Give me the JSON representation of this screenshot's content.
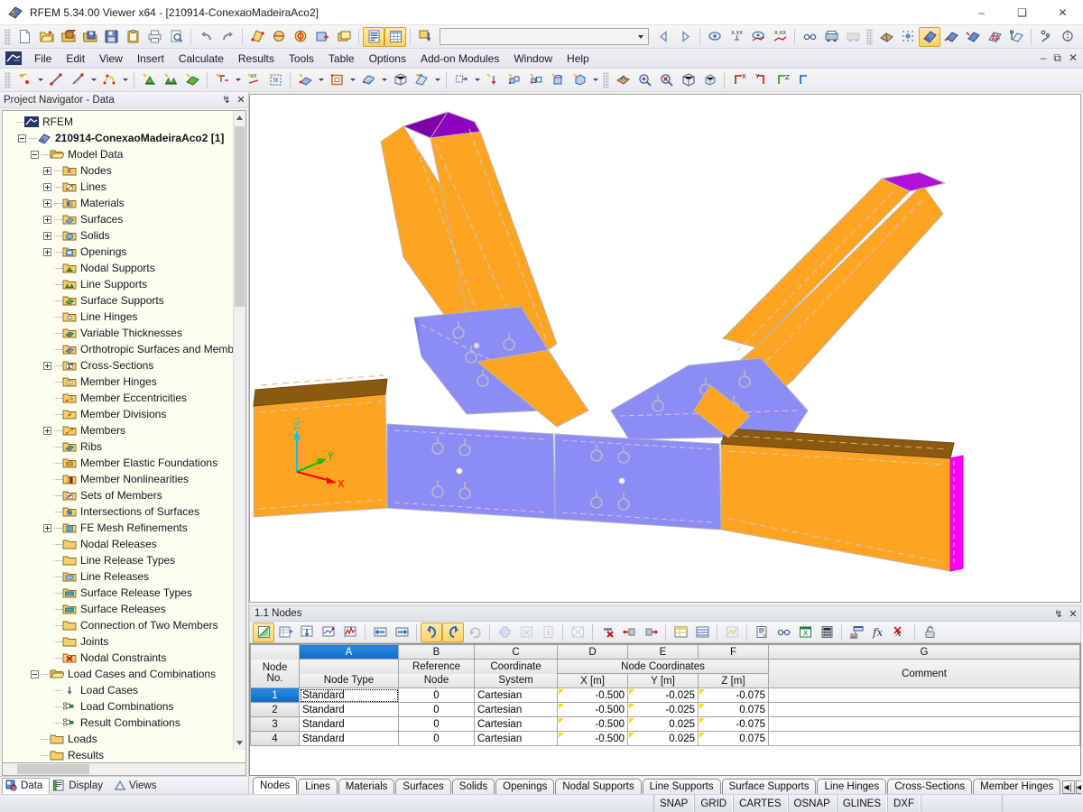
{
  "window": {
    "title": "RFEM 5.34.00 Viewer x64 - [210914-ConexaoMadeiraAco2]",
    "minimize": "–",
    "maximize": "❑",
    "close": "✕"
  },
  "menubar": {
    "items": [
      "File",
      "Edit",
      "View",
      "Insert",
      "Calculate",
      "Results",
      "Tools",
      "Table",
      "Options",
      "Add-on Modules",
      "Window",
      "Help"
    ]
  },
  "toolbar_main": {
    "combo_value": "",
    "buttons": [
      "new-file-icon",
      "open-file-icon",
      "open-model-icon",
      "save-as-icon",
      "save-icon",
      "clipboard-icon",
      "print-icon",
      "print-preview-icon",
      "undo-icon",
      "redo-icon",
      "edit-model-icon",
      "render-icon",
      "results-icon",
      "selection-icon",
      "layers-icon",
      "printout-report-icon",
      "tables-icon",
      "load-case-icon"
    ],
    "buttons_right": [
      "prev-loadcase-icon",
      "next-loadcase-icon",
      "display-results-icon",
      "value-min-icon",
      "results-on-surface-icon",
      "value-max-icon",
      "glasses-icon",
      "rendering-icon",
      "mesh-icon",
      "fe-mesh-icon",
      "mesh-settings-icon",
      "model-iso-icon",
      "model-xy-icon",
      "model-xz-icon",
      "grid-icon",
      "work-plane-icon",
      "node-snap-icon",
      "rotate-icon",
      "mirror-icon",
      "intersect-icon",
      "info-icon",
      "notes-icon",
      "excel-export-icon"
    ]
  },
  "toolbar_insert": {
    "buttons": [
      "new-node-icon",
      "new-line-icon",
      "new-member-icon",
      "new-polyline-icon",
      "new-support-icon",
      "new-line-support-icon",
      "new-surface-support-icon",
      "new-nodal-load-icon",
      "new-member-load-icon",
      "new-area-load-icon",
      "new-surface-icon",
      "new-opening-icon",
      "new-solid-icon",
      "new-block-icon",
      "new-dimension-icon",
      "copy-icon",
      "extrude-icon",
      "move-icon",
      "scale-icon",
      "rotate-model-icon",
      "divide-icon",
      "generate-icon",
      "select-icon",
      "zoom-in-icon",
      "zoom-out-icon",
      "show-all-icon",
      "perspective-icon",
      "view-x-icon",
      "view-y-icon",
      "view-z-icon",
      "view-iso-icon"
    ]
  },
  "navigator": {
    "title": "Project Navigator - Data",
    "pin": "↯",
    "close": "✕",
    "tree": [
      {
        "level": 0,
        "label": "RFEM",
        "icon": "rfem-icon",
        "exp": "none",
        "bold": false
      },
      {
        "level": 1,
        "label": "210914-ConexaoMadeiraAco2 [1]",
        "icon": "model-icon",
        "exp": "minus",
        "bold": true
      },
      {
        "level": 2,
        "label": "Model Data",
        "icon": "folder-open-icon",
        "exp": "minus",
        "bold": false
      },
      {
        "level": 3,
        "label": "Nodes",
        "icon": "nodes-icon",
        "exp": "plus",
        "bold": false
      },
      {
        "level": 3,
        "label": "Lines",
        "icon": "lines-icon",
        "exp": "plus",
        "bold": false
      },
      {
        "level": 3,
        "label": "Materials",
        "icon": "materials-icon",
        "exp": "plus",
        "bold": false
      },
      {
        "level": 3,
        "label": "Surfaces",
        "icon": "surfaces-icon",
        "exp": "plus",
        "bold": false
      },
      {
        "level": 3,
        "label": "Solids",
        "icon": "solids-icon",
        "exp": "plus",
        "bold": false
      },
      {
        "level": 3,
        "label": "Openings",
        "icon": "openings-icon",
        "exp": "plus",
        "bold": false
      },
      {
        "level": 3,
        "label": "Nodal Supports",
        "icon": "nodal-support-icon",
        "exp": "none",
        "bold": false
      },
      {
        "level": 3,
        "label": "Line Supports",
        "icon": "line-support-icon",
        "exp": "none",
        "bold": false
      },
      {
        "level": 3,
        "label": "Surface Supports",
        "icon": "surface-support-icon",
        "exp": "none",
        "bold": false
      },
      {
        "level": 3,
        "label": "Line Hinges",
        "icon": "line-hinge-icon",
        "exp": "none",
        "bold": false
      },
      {
        "level": 3,
        "label": "Variable Thicknesses",
        "icon": "thickness-icon",
        "exp": "none",
        "bold": false
      },
      {
        "level": 3,
        "label": "Orthotropic Surfaces and Memb",
        "icon": "orthotropic-icon",
        "exp": "none",
        "bold": false
      },
      {
        "level": 3,
        "label": "Cross-Sections",
        "icon": "cross-section-icon",
        "exp": "plus",
        "bold": false
      },
      {
        "level": 3,
        "label": "Member Hinges",
        "icon": "member-hinge-icon",
        "exp": "none",
        "bold": false
      },
      {
        "level": 3,
        "label": "Member Eccentricities",
        "icon": "eccentricity-icon",
        "exp": "none",
        "bold": false
      },
      {
        "level": 3,
        "label": "Member Divisions",
        "icon": "division-icon",
        "exp": "none",
        "bold": false
      },
      {
        "level": 3,
        "label": "Members",
        "icon": "members-icon",
        "exp": "plus",
        "bold": false
      },
      {
        "level": 3,
        "label": "Ribs",
        "icon": "ribs-icon",
        "exp": "none",
        "bold": false
      },
      {
        "level": 3,
        "label": "Member Elastic Foundations",
        "icon": "foundation-icon",
        "exp": "none",
        "bold": false
      },
      {
        "level": 3,
        "label": "Member Nonlinearities",
        "icon": "nonlinearity-icon",
        "exp": "none",
        "bold": false
      },
      {
        "level": 3,
        "label": "Sets of Members",
        "icon": "member-set-icon",
        "exp": "none",
        "bold": false
      },
      {
        "level": 3,
        "label": "Intersections of Surfaces",
        "icon": "intersection-icon",
        "exp": "none",
        "bold": false
      },
      {
        "level": 3,
        "label": "FE Mesh Refinements",
        "icon": "fe-mesh-icon",
        "exp": "plus",
        "bold": false
      },
      {
        "level": 3,
        "label": "Nodal Releases",
        "icon": "folder-icon",
        "exp": "none",
        "bold": false
      },
      {
        "level": 3,
        "label": "Line Release Types",
        "icon": "folder-icon",
        "exp": "none",
        "bold": false
      },
      {
        "level": 3,
        "label": "Line Releases",
        "icon": "folder-blue-icon",
        "exp": "none",
        "bold": false
      },
      {
        "level": 3,
        "label": "Surface Release Types",
        "icon": "folder-teal-icon",
        "exp": "none",
        "bold": false
      },
      {
        "level": 3,
        "label": "Surface Releases",
        "icon": "folder-teal-icon",
        "exp": "none",
        "bold": false
      },
      {
        "level": 3,
        "label": "Connection of Two Members",
        "icon": "folder-icon",
        "exp": "none",
        "bold": false
      },
      {
        "level": 3,
        "label": "Joints",
        "icon": "folder-icon",
        "exp": "none",
        "bold": false
      },
      {
        "level": 3,
        "label": "Nodal Constraints",
        "icon": "constraint-icon",
        "exp": "none",
        "bold": false
      },
      {
        "level": 2,
        "label": "Load Cases and Combinations",
        "icon": "folder-open-icon",
        "exp": "minus",
        "bold": false
      },
      {
        "level": 3,
        "label": "Load Cases",
        "icon": "load-case-icon",
        "exp": "none",
        "bold": false
      },
      {
        "level": 3,
        "label": "Load Combinations",
        "icon": "load-comb-icon",
        "exp": "none",
        "bold": false
      },
      {
        "level": 3,
        "label": "Result Combinations",
        "icon": "result-comb-icon",
        "exp": "none",
        "bold": false
      },
      {
        "level": 2,
        "label": "Loads",
        "icon": "folder-icon",
        "exp": "none",
        "bold": false
      },
      {
        "level": 2,
        "label": "Results",
        "icon": "folder-icon",
        "exp": "none",
        "bold": false
      }
    ],
    "bottom_tabs": [
      {
        "label": "Data",
        "icon": "data-icon",
        "selected": true
      },
      {
        "label": "Display",
        "icon": "display-icon",
        "selected": false
      },
      {
        "label": "Views",
        "icon": "views-icon",
        "selected": false
      }
    ]
  },
  "viewport": {
    "axis_labels": {
      "x": "X",
      "y": "Y",
      "z": "Z"
    },
    "axis_colors": {
      "x": "#ff0000",
      "y": "#00c000",
      "z": "#00c8f0"
    },
    "model_colors": {
      "timber": "#FFA421",
      "timber_dark": "#8B5A10",
      "steel_plate": "#8C8CF5",
      "end_magenta": "#FF00FF",
      "end_purple": "#9000C0",
      "edge": "#b8b8b8"
    }
  },
  "table_panel": {
    "title": "1.1 Nodes",
    "pin": "↯",
    "close": "✕",
    "toolbar_buttons": [
      "table-edit-icon",
      "insert-row-icon",
      "fill-down-icon",
      "interpolate-icon",
      "chart-icon",
      "prev-table-icon",
      "next-table-icon",
      "undo-icon",
      "redo-icon",
      "refresh-icon",
      "add-icon",
      "delete-selection-icon",
      "info-icon",
      "clear-table-icon",
      "delete-row-icon",
      "delete-left-icon",
      "delete-right-icon",
      "table-format-icon",
      "table-grid-icon",
      "graph-icon",
      "print-report-icon",
      "glasses-icon",
      "excel-icon",
      "calculator-icon",
      "units-icon",
      "fx-icon",
      "fx-clear-icon",
      "lock-icon"
    ],
    "columns": [
      {
        "letter": "",
        "group": "",
        "sub": "Node\nNo.",
        "selected": false
      },
      {
        "letter": "A",
        "group": "",
        "sub": "Node Type",
        "selected": true
      },
      {
        "letter": "B",
        "group": "",
        "sub": "Reference\nNode",
        "selected": false
      },
      {
        "letter": "C",
        "group": "",
        "sub": "Coordinate\nSystem",
        "selected": false
      },
      {
        "letter": "D",
        "group": "Node Coordinates",
        "sub": "X [m]",
        "selected": false
      },
      {
        "letter": "E",
        "group": "Node Coordinates",
        "sub": "Y [m]",
        "selected": false
      },
      {
        "letter": "F",
        "group": "Node Coordinates",
        "sub": "Z [m]",
        "selected": false
      },
      {
        "letter": "G",
        "group": "",
        "sub": "Comment",
        "selected": false
      }
    ],
    "col_header_labels": {
      "node_no": "Node",
      "node_no2": "No.",
      "node_type": "Node Type",
      "ref1": "Reference",
      "ref2": "Node",
      "cs1": "Coordinate",
      "cs2": "System",
      "group_coords": "Node Coordinates",
      "x": "X [m]",
      "y": "Y [m]",
      "z": "Z [m]",
      "comment": "Comment"
    },
    "rows": [
      {
        "no": "1",
        "type": "Standard",
        "ref": "0",
        "cs": "Cartesian",
        "x": "-0.500",
        "y": "-0.025",
        "z": "-0.075",
        "comment": "",
        "selected": true
      },
      {
        "no": "2",
        "type": "Standard",
        "ref": "0",
        "cs": "Cartesian",
        "x": "-0.500",
        "y": "-0.025",
        "z": "0.075",
        "comment": "",
        "selected": false
      },
      {
        "no": "3",
        "type": "Standard",
        "ref": "0",
        "cs": "Cartesian",
        "x": "-0.500",
        "y": "0.025",
        "z": "-0.075",
        "comment": "",
        "selected": false
      },
      {
        "no": "4",
        "type": "Standard",
        "ref": "0",
        "cs": "Cartesian",
        "x": "-0.500",
        "y": "0.025",
        "z": "0.075",
        "comment": "",
        "selected": false
      }
    ],
    "tabs": [
      {
        "label": "Nodes",
        "selected": true
      },
      {
        "label": "Lines",
        "selected": false
      },
      {
        "label": "Materials",
        "selected": false
      },
      {
        "label": "Surfaces",
        "selected": false
      },
      {
        "label": "Solids",
        "selected": false
      },
      {
        "label": "Openings",
        "selected": false
      },
      {
        "label": "Nodal Supports",
        "selected": false
      },
      {
        "label": "Line Supports",
        "selected": false
      },
      {
        "label": "Surface Supports",
        "selected": false
      },
      {
        "label": "Line Hinges",
        "selected": false
      },
      {
        "label": "Cross-Sections",
        "selected": false
      },
      {
        "label": "Member Hinges",
        "selected": false
      }
    ],
    "nav_buttons": [
      "◀│",
      "◀",
      "▶",
      "│▶"
    ]
  },
  "statusbar": {
    "cells": [
      "SNAP",
      "GRID",
      "CARTES",
      "OSNAP",
      "GLINES",
      "DXF"
    ]
  }
}
